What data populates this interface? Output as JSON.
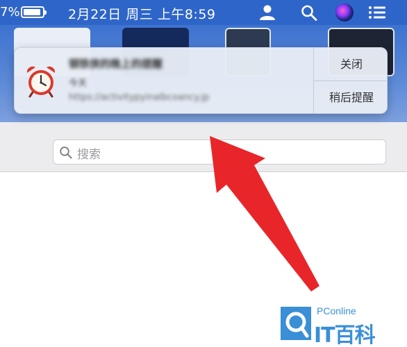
{
  "menubar": {
    "battery_percent": "7%",
    "datetime": "2月22日 周三 上午8:59",
    "icons": [
      "battery-icon",
      "user-icon",
      "search-icon",
      "siri-icon",
      "control-center-icon"
    ],
    "bar_color": "#2e65c8"
  },
  "notification": {
    "title": "钢铁侠的晚上的提醒",
    "subtitle": "今天",
    "url": "https://activitypyinalbcoancy.jp",
    "icon": "alarm-clock-icon",
    "close_label": "关闭",
    "snooze_label": "稍后提醒"
  },
  "search": {
    "placeholder": "搜索"
  },
  "watermark": {
    "small": "PConline",
    "big": "IT百科",
    "color": "#3a8fd6"
  },
  "annotation": {
    "arrow_color": "#e8262a"
  }
}
